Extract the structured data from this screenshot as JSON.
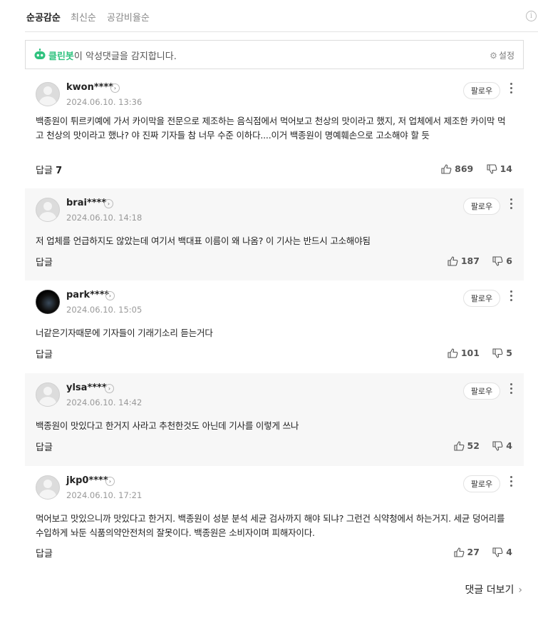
{
  "sort_tabs": [
    {
      "label": "순공감순",
      "active": true
    },
    {
      "label": "최신순",
      "active": false
    },
    {
      "label": "공감비율순",
      "active": false
    }
  ],
  "info_icon": "info-icon",
  "cleanbot": {
    "name": "클린봇",
    "message": "이 악성댓글을 감지합니다.",
    "settings_label": "설정",
    "accent_color": "#2ec27e"
  },
  "follow_label": "팔로우",
  "reply_label": "답글",
  "comments": [
    {
      "nickname": "kwon****",
      "date": "2024.06.10. 13:36",
      "text": "백종원이 튀르키예에 가서 카이막을 전문으로 제조하는 음식점에서 먹어보고 천상의 맛이라고 했지, 저 업체에서 제조한 카이막 먹고 천상의 맛이라고 했나? 야 진짜 기자들 참 너무 수준 이하다....이거 백종원이 명예훼손으로 고소해야 할 듯",
      "reply_count": "7",
      "likes": "869",
      "dislikes": "14",
      "avatar": "default"
    },
    {
      "nickname": "brai****",
      "date": "2024.06.10. 14:18",
      "text": "저 업체를 언급하지도 않았는데 여기서 백대표 이름이 왜 나옴? 이 기사는 반드시 고소해야됨",
      "reply_count": "",
      "likes": "187",
      "dislikes": "6",
      "avatar": "default"
    },
    {
      "nickname": "park****",
      "date": "2024.06.10. 15:05",
      "text": "너같은기자때문에 기자들이 기래기소리 듣는거다",
      "reply_count": "",
      "likes": "101",
      "dislikes": "5",
      "avatar": "photo"
    },
    {
      "nickname": "ylsa****",
      "date": "2024.06.10. 14:42",
      "text": "백종원이 맛있다고 한거지 사라고 추천한것도 아닌데 기사를 이렇게 쓰나",
      "reply_count": "",
      "likes": "52",
      "dislikes": "4",
      "avatar": "default"
    },
    {
      "nickname": "jkp0****",
      "date": "2024.06.10. 17:21",
      "text": "먹어보고 맛있으니까 맛있다고 한거지. 백종원이 성분 분석 세균 검사까지 해야 되냐? 그런건 식약청에서 하는거지. 세균 덩어리를 수입하게 놔둔 식품의약안전처의 잘못이다. 백종원은 소비자이며 피해자이다.",
      "reply_count": "",
      "likes": "27",
      "dislikes": "4",
      "avatar": "default"
    }
  ],
  "more_comments_label": "댓글 더보기"
}
